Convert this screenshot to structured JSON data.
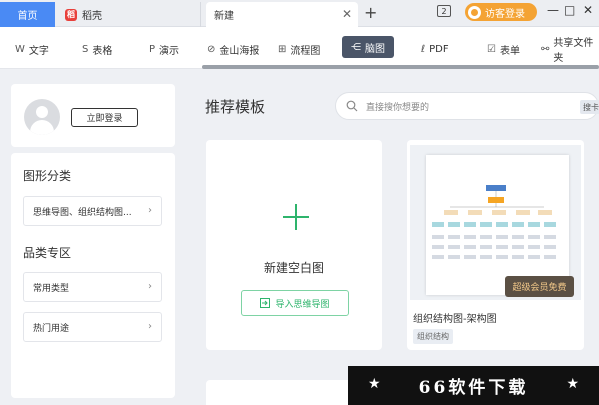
{
  "titlebar": {
    "tabs": [
      {
        "label": "首页"
      },
      {
        "label": "稻壳",
        "icon": "daoke-logo-icon"
      },
      {
        "label": "新建"
      }
    ],
    "new_tab_symbol": "+",
    "window_count": "2",
    "visitor_login": "访客登录",
    "controls": [
      "—",
      "□",
      "✕"
    ]
  },
  "toolbar": {
    "items": [
      {
        "label": "文字",
        "icon": "W"
      },
      {
        "label": "表格",
        "icon": "S"
      },
      {
        "label": "演示",
        "icon": "P"
      },
      {
        "label": "金山海报",
        "icon": "poster-icon"
      },
      {
        "label": "流程图",
        "icon": "flowchart-icon"
      },
      {
        "label": "脑图",
        "icon": "mindmap-icon",
        "active": true
      },
      {
        "label": "PDF",
        "icon": "pdf-icon"
      },
      {
        "label": "表单",
        "icon": "form-icon"
      },
      {
        "label": "共享文件夹",
        "icon": "share-folder-icon"
      }
    ]
  },
  "sidebar": {
    "login_label": "立即登录",
    "sections": [
      {
        "title": "图形分类",
        "items": [
          "思维导图、组织结构图..."
        ]
      },
      {
        "title": "品类专区",
        "items": [
          "常用类型",
          "热门用途"
        ]
      }
    ]
  },
  "main": {
    "title": "推荐模板",
    "search_placeholder": "直接搜你想要的",
    "search_button": "搜卡",
    "new_blank_label": "新建空白图",
    "import_label": "导入思维导图",
    "template": {
      "badge": "超级会员免费",
      "title": "组织结构图-架构图",
      "tag": "组织结构"
    }
  },
  "watermark": {
    "text": "66软件下载"
  },
  "colors": {
    "accent": "#4a8af4",
    "green": "#2eb46c",
    "visitor": "#f4a334"
  }
}
